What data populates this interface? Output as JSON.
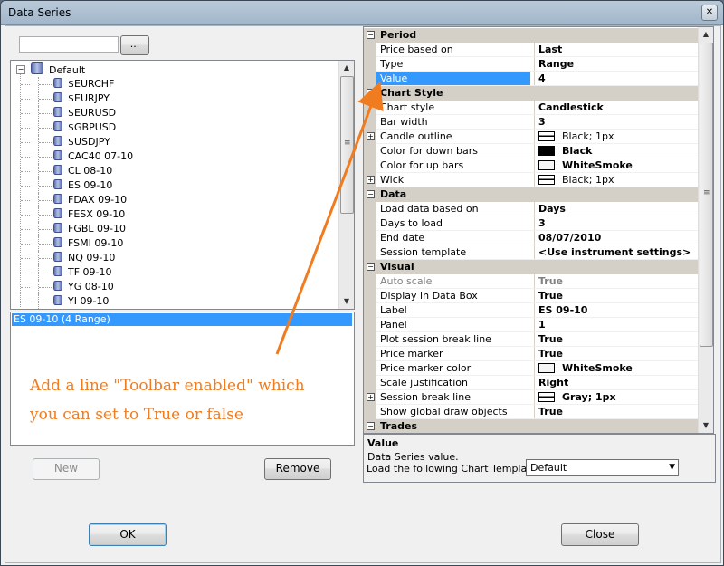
{
  "window": {
    "title": "Data Series",
    "close_glyph": "✕"
  },
  "left": {
    "search_value": "",
    "browse_label": "...",
    "tree": {
      "root": "Default",
      "items": [
        "$EURCHF",
        "$EURJPY",
        "$EURUSD",
        "$GBPUSD",
        "$USDJPY",
        "CAC40 07-10",
        "CL 08-10",
        "ES 09-10",
        "FDAX 09-10",
        "FESX 09-10",
        "FGBL 09-10",
        "FSMI 09-10",
        "NQ 09-10",
        "TF 09-10",
        "YG 08-10",
        "YI 09-10"
      ]
    },
    "selected_series": "ES 09-10 (4 Range)",
    "annotation_line1": "Add a line \"Toolbar enabled\" which",
    "annotation_line2": "you can set to True or false",
    "new_label": "New",
    "remove_label": "Remove"
  },
  "grid": {
    "categories": {
      "period": "Period",
      "chart_style": "Chart Style",
      "data": "Data",
      "visual": "Visual",
      "trades": "Trades"
    },
    "rows": {
      "price_based_on": [
        "Price based on",
        "Last"
      ],
      "type": [
        "Type",
        "Range"
      ],
      "value": [
        "Value",
        "4"
      ],
      "chart_style": [
        "Chart style",
        "Candlestick"
      ],
      "bar_width": [
        "Bar width",
        "3"
      ],
      "candle_outline": [
        "Candle outline",
        "Black; 1px"
      ],
      "color_down": [
        "Color for down bars",
        "Black"
      ],
      "color_up": [
        "Color for up bars",
        "WhiteSmoke"
      ],
      "wick": [
        "Wick",
        "Black; 1px"
      ],
      "load_based_on": [
        "Load data based on",
        "Days"
      ],
      "days_to_load": [
        "Days to load",
        "3"
      ],
      "end_date": [
        "End date",
        "08/07/2010"
      ],
      "session_template": [
        "Session template",
        "<Use instrument settings>"
      ],
      "auto_scale": [
        "Auto scale",
        "True"
      ],
      "display_data_box": [
        "Display in Data Box",
        "True"
      ],
      "label": [
        "Label",
        "ES 09-10"
      ],
      "panel": [
        "Panel",
        "1"
      ],
      "plot_session_break": [
        "Plot session break line",
        "True"
      ],
      "price_marker": [
        "Price marker",
        "True"
      ],
      "price_marker_color": [
        "Price marker color",
        "WhiteSmoke"
      ],
      "scale_justification": [
        "Scale justification",
        "Right"
      ],
      "session_break_line": [
        "Session break line",
        "Gray; 1px"
      ],
      "show_global_draw": [
        "Show global draw objects",
        "True"
      ]
    },
    "expander_plus": "+",
    "expander_minus": "−"
  },
  "description": {
    "title": "Value",
    "text": "Data Series value.",
    "template_label": "Load the following Chart Template:",
    "template_value": "Default"
  },
  "footer": {
    "ok_label": "OK",
    "close_label": "Close"
  },
  "colors": {
    "annotation": "#f07c1f",
    "selection": "#3399ff",
    "category_bg": "#d4d0c8"
  }
}
